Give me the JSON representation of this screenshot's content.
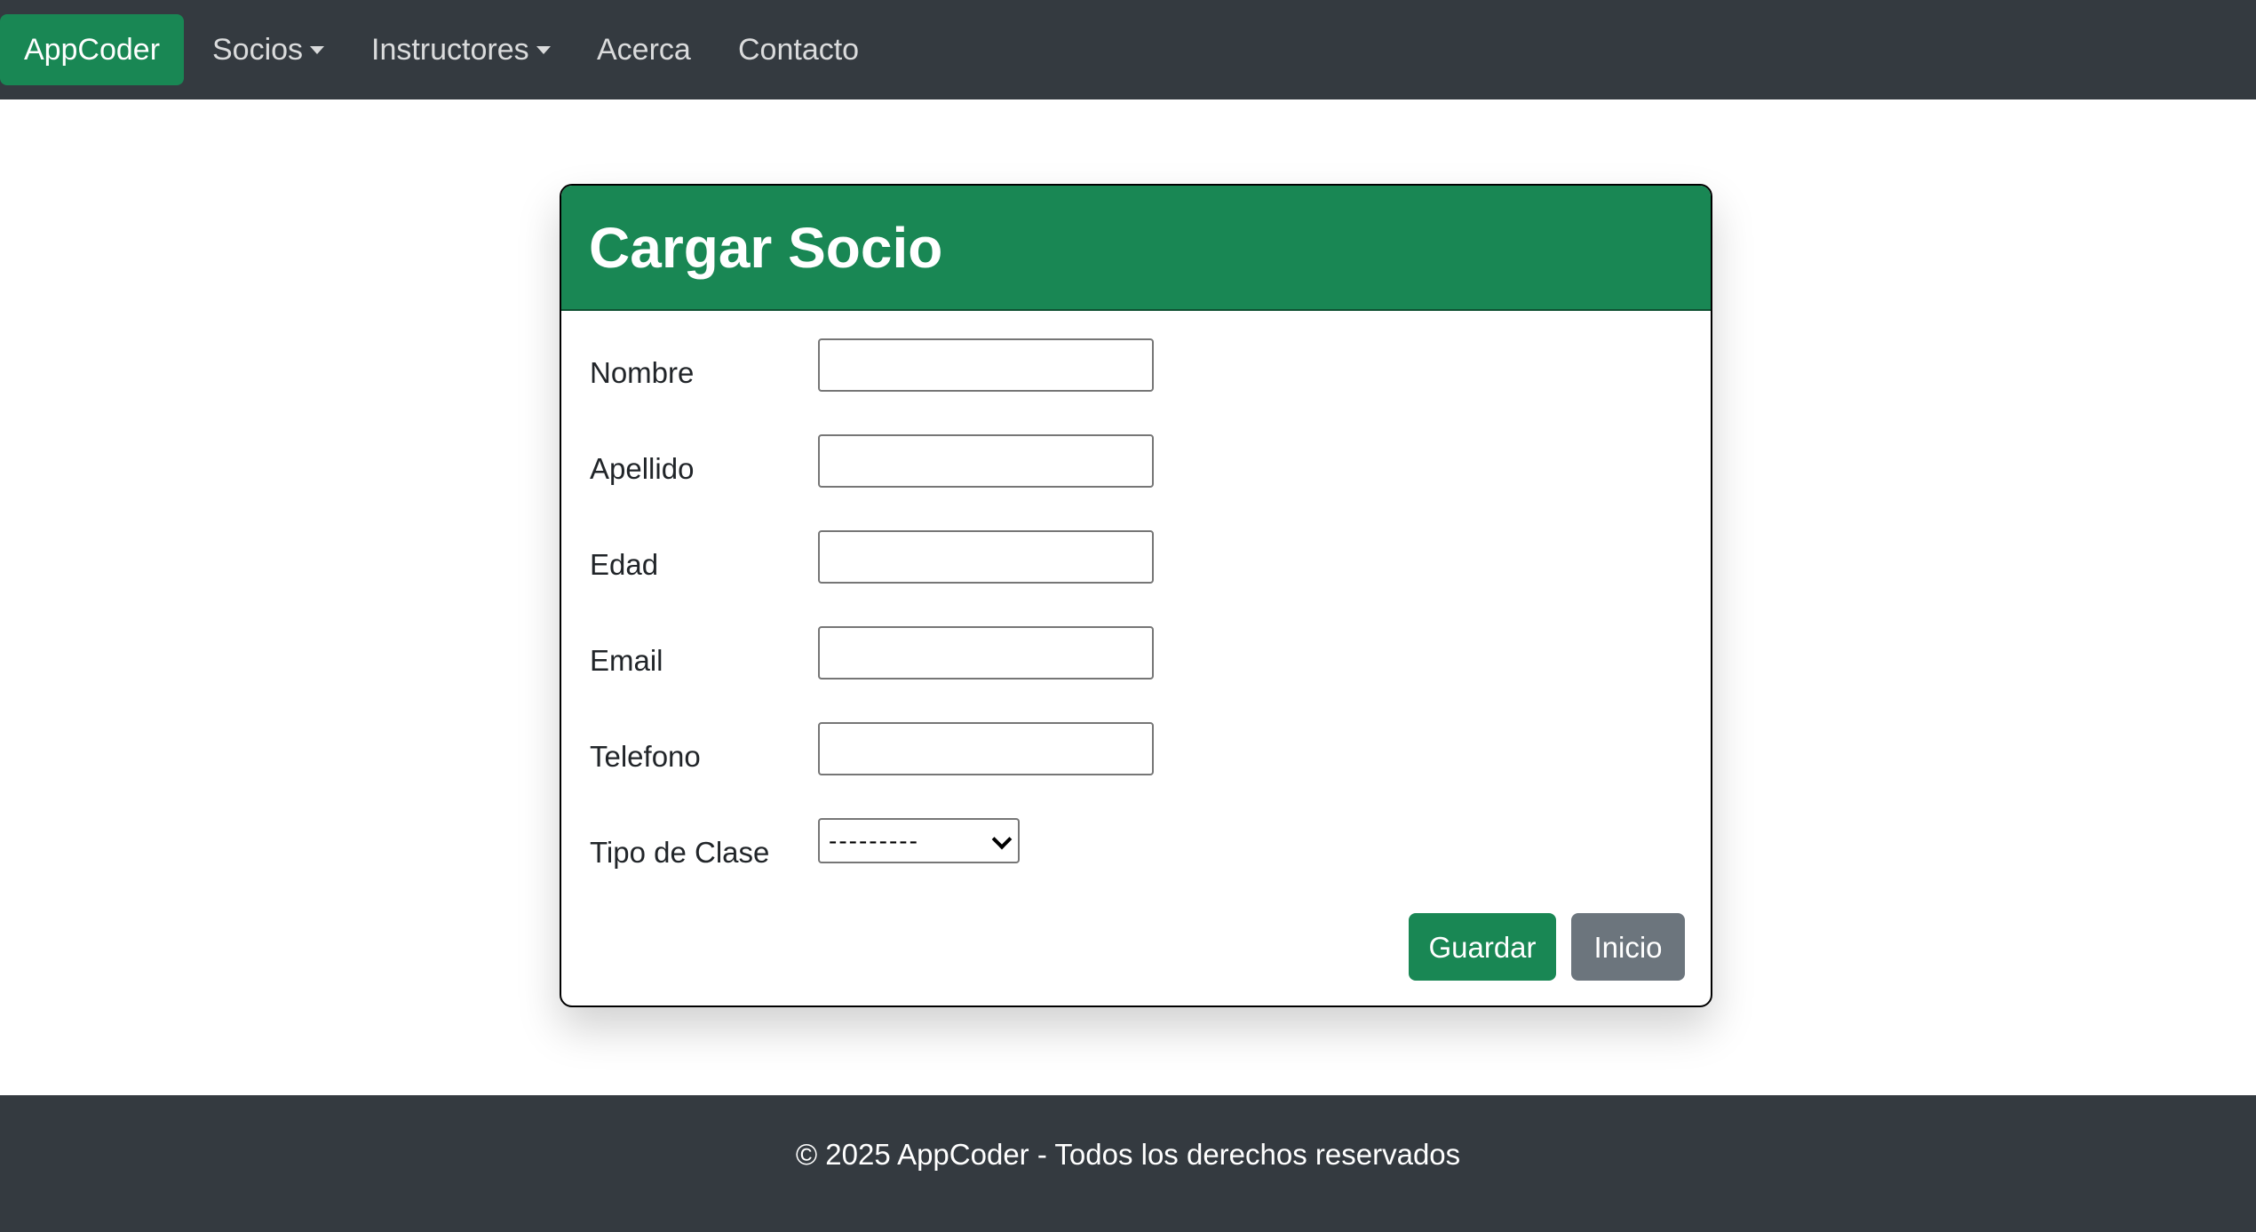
{
  "navbar": {
    "brand": "AppCoder",
    "items": [
      {
        "label": "Socios",
        "dropdown": true
      },
      {
        "label": "Instructores",
        "dropdown": true
      },
      {
        "label": "Acerca",
        "dropdown": false
      },
      {
        "label": "Contacto",
        "dropdown": false
      }
    ]
  },
  "form": {
    "title": "Cargar Socio",
    "fields": [
      {
        "label": "Nombre",
        "value": ""
      },
      {
        "label": "Apellido",
        "value": ""
      },
      {
        "label": "Edad",
        "value": ""
      },
      {
        "label": "Email",
        "value": ""
      },
      {
        "label": "Telefono",
        "value": ""
      }
    ],
    "select": {
      "label": "Tipo de Clase",
      "selected": "---------"
    },
    "buttons": {
      "save": "Guardar",
      "home": "Inicio"
    }
  },
  "footer": {
    "text": "© 2025 AppCoder - Todos los derechos reservados"
  },
  "colors": {
    "navbar_bg": "#343a40",
    "brand_green": "#198754",
    "secondary_gray": "#6c757d",
    "footer_bg": "#343a40"
  }
}
